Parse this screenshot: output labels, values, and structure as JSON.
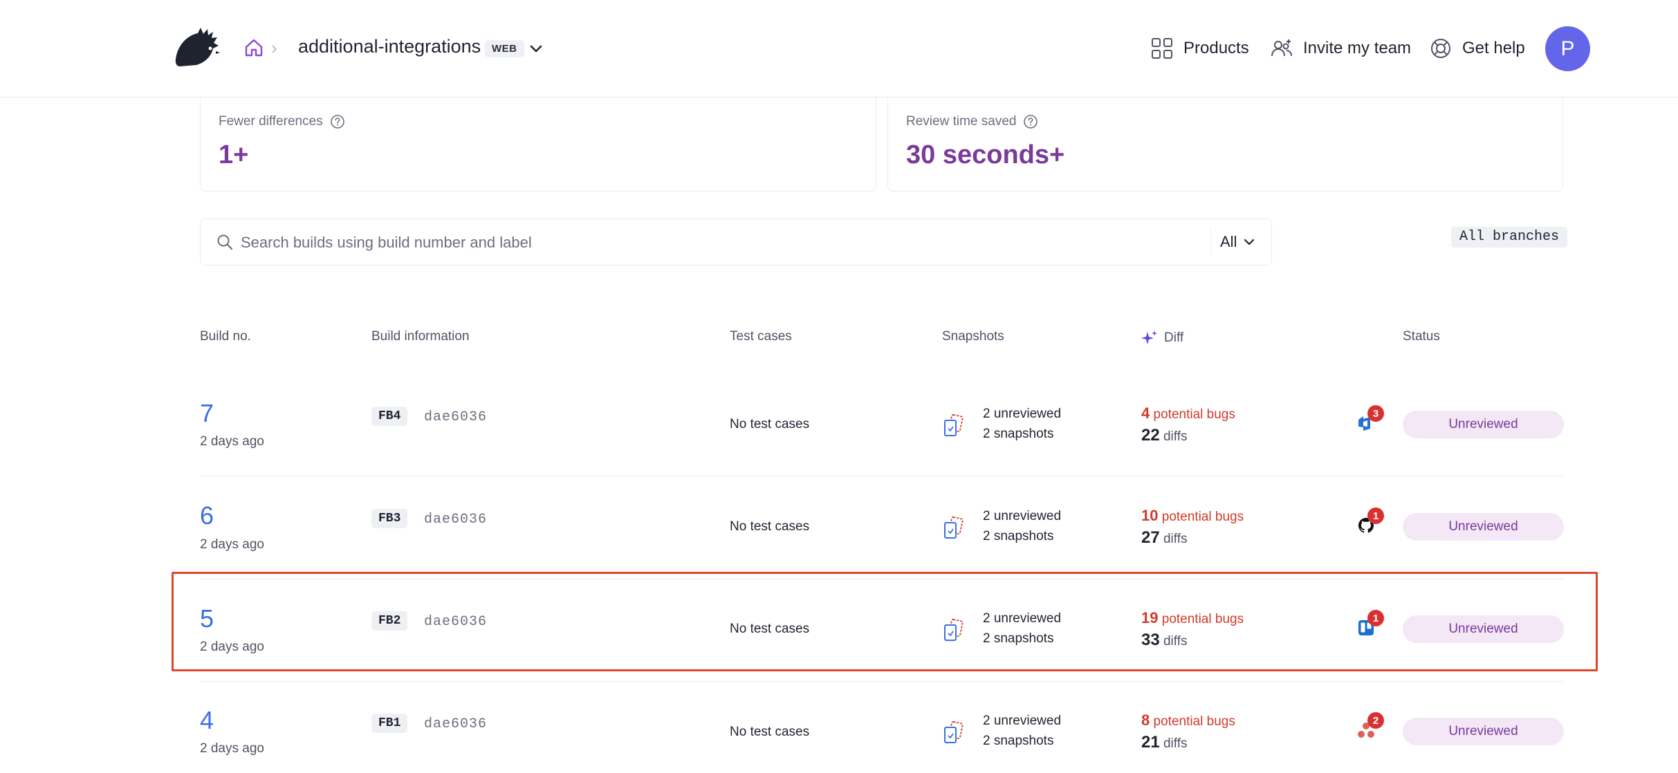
{
  "header": {
    "project_name": "additional-integrations",
    "platform_badge": "WEB",
    "nav": {
      "products": "Products",
      "invite": "Invite my team",
      "help": "Get help"
    },
    "avatar_initial": "P"
  },
  "stats": {
    "fewer_differences": {
      "label": "Fewer differences",
      "value": "1+"
    },
    "review_time_saved": {
      "label": "Review time saved",
      "value": "30 seconds+"
    }
  },
  "search": {
    "placeholder": "Search builds using build number and label",
    "filter_value": "All",
    "branches": "All branches"
  },
  "table": {
    "headers": {
      "build_no": "Build no.",
      "build_info": "Build information",
      "test_cases": "Test cases",
      "snapshots": "Snapshots",
      "diff": "Diff",
      "status": "Status"
    },
    "rows": [
      {
        "number": "7",
        "time": "2 days ago",
        "label": "FB4",
        "commit": "dae6036",
        "test_cases": "No test cases",
        "unreviewed": "2 unreviewed",
        "snapshots": "2 snapshots",
        "bugs_count": "4",
        "bugs_label": "potential bugs",
        "diffs_count": "22",
        "diffs_label": "diffs",
        "integration": "azure-devops-icon",
        "integration_count": "3",
        "status": "Unreviewed"
      },
      {
        "number": "6",
        "time": "2 days ago",
        "label": "FB3",
        "commit": "dae6036",
        "test_cases": "No test cases",
        "unreviewed": "2 unreviewed",
        "snapshots": "2 snapshots",
        "bugs_count": "10",
        "bugs_label": "potential bugs",
        "diffs_count": "27",
        "diffs_label": "diffs",
        "integration": "github-icon",
        "integration_count": "1",
        "status": "Unreviewed"
      },
      {
        "number": "5",
        "time": "2 days ago",
        "label": "FB2",
        "commit": "dae6036",
        "test_cases": "No test cases",
        "unreviewed": "2 unreviewed",
        "snapshots": "2 snapshots",
        "bugs_count": "19",
        "bugs_label": "potential bugs",
        "diffs_count": "33",
        "diffs_label": "diffs",
        "integration": "trello-icon",
        "integration_count": "1",
        "status": "Unreviewed"
      },
      {
        "number": "4",
        "time": "2 days ago",
        "label": "FB1",
        "commit": "dae6036",
        "test_cases": "No test cases",
        "unreviewed": "2 unreviewed",
        "snapshots": "2 snapshots",
        "bugs_count": "8",
        "bugs_label": "potential bugs",
        "diffs_count": "21",
        "diffs_label": "diffs",
        "integration": "asana-icon",
        "integration_count": "2",
        "status": "Unreviewed"
      }
    ]
  },
  "colors": {
    "accent": "#7b3a9a",
    "link": "#3a6ee8",
    "bug": "#d03a2b",
    "highlight": "#e2452c",
    "status_bg": "#f4e7f6"
  }
}
